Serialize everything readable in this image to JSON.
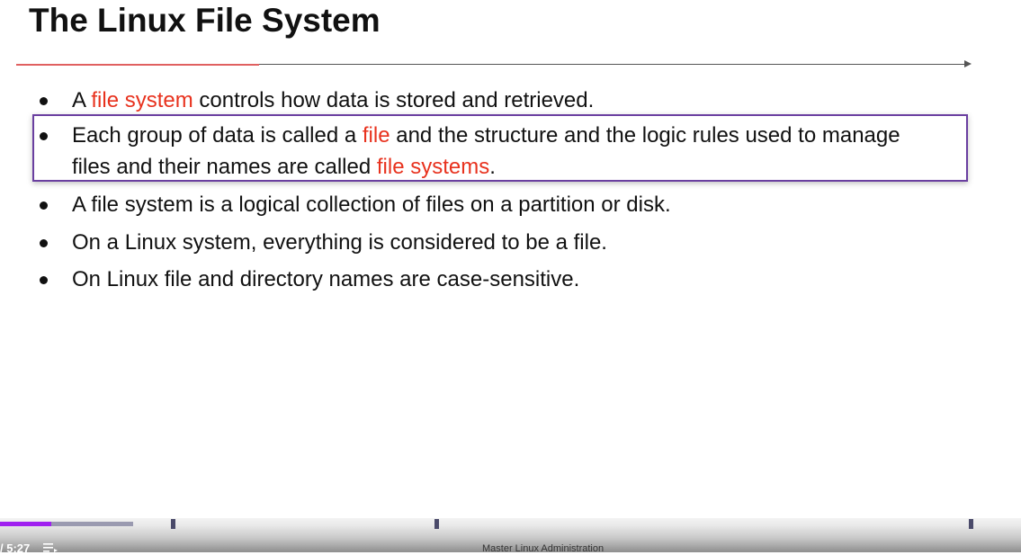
{
  "slide": {
    "title": "The Linux File System",
    "bullets": [
      [
        {
          "text": "A ",
          "red": false
        },
        {
          "text": "file system",
          "red": true
        },
        {
          "text": " controls how data is stored and retrieved.",
          "red": false
        }
      ],
      [
        {
          "text": "Each group of data is called a ",
          "red": false
        },
        {
          "text": "file",
          "red": true
        },
        {
          "text": " and the structure and the logic rules used to manage",
          "red": false
        }
      ],
      [
        {
          "text": "files and their names are called ",
          "red": false
        },
        {
          "text": "file systems",
          "red": true
        },
        {
          "text": ".",
          "red": false
        }
      ],
      [
        {
          "text": "A file system is a logical collection of files on a partition or disk.",
          "red": false
        }
      ],
      [
        {
          "text": "On a Linux system, everything is considered to be a file.",
          "red": false
        }
      ],
      [
        {
          "text": "On Linux file and directory names are case-sensitive.",
          "red": false
        }
      ]
    ],
    "accent_color": "#e8321e",
    "highlight_color": "#6a3fa0"
  },
  "player": {
    "time": "/ 5:27",
    "video_title": "Master Linux Administration",
    "progress_percent": 10,
    "buffered_percent": 13,
    "progress_color": "#a020f0",
    "menu_icon": "chapters-list-icon"
  }
}
